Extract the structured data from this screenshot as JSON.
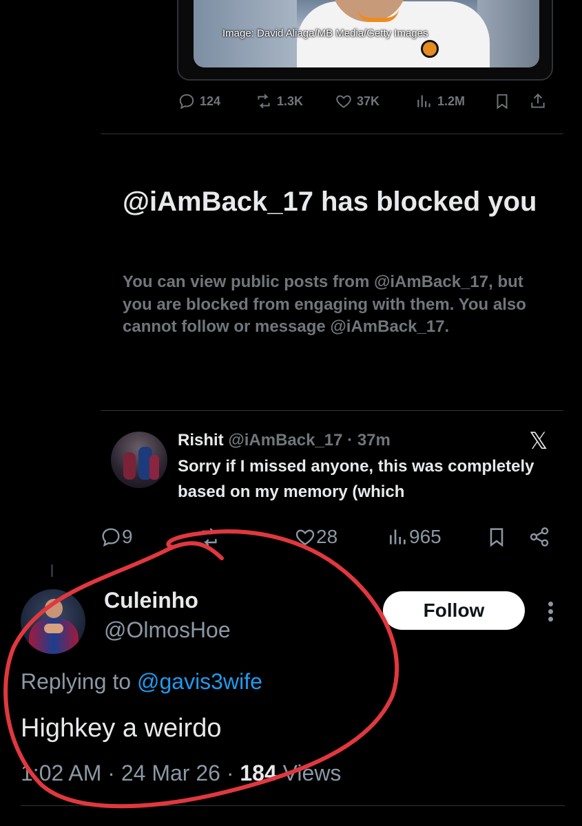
{
  "quoted_card": {
    "image_credit": "Image: David Aliaga/MB Media/Getty Images"
  },
  "tweet_actions": {
    "replies": "124",
    "reposts": "1.3K",
    "likes": "37K",
    "views": "1.2M"
  },
  "blocked_notice": {
    "title": "@iAmBack_17 has blocked you",
    "body": "You can view public posts from @iAmBack_17, but you are blocked from engaging with them. You also cannot follow or message @iAmBack_17."
  },
  "embedded_tweet": {
    "name": "Rishit",
    "handle_time": "@iAmBack_17 · 37m",
    "x_logo": "𝕏",
    "text": "Sorry if I missed anyone, this was completely based on my memory (which"
  },
  "embed_actions": {
    "replies": "9",
    "likes": "28",
    "views": "965"
  },
  "reply_tweet": {
    "display_name": "Culeinho",
    "handle": "@OlmosHoe",
    "follow_label": "Follow",
    "replying_prefix": "Replying to ",
    "replying_to": "@gavis3wife",
    "text": "Highkey a weirdo",
    "time": "1:02 AM · 24 Mar 26 · ",
    "views_count": "184",
    "views_label": " Views"
  },
  "colors": {
    "background": "#000000",
    "secondary_text": "#71767b",
    "link": "#1d9bf0",
    "annotation": "#e0383e"
  }
}
